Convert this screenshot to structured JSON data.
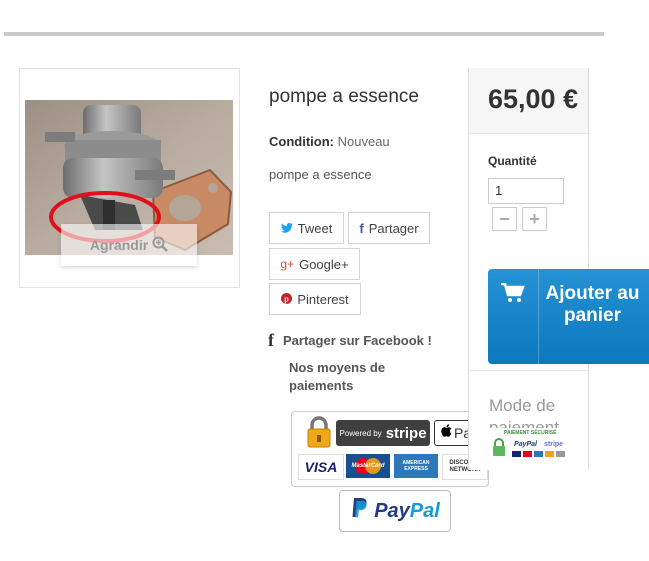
{
  "product": {
    "title": "pompe a essence",
    "condition_label": "Condition:",
    "condition_value": "Nouveau",
    "short_description": "pompe a essence",
    "zoom_label": "Agrandir",
    "zoom_icon": "magnifier-plus-icon"
  },
  "share": {
    "tweet": "Tweet",
    "partager": "Partager",
    "google": "Google+",
    "pinterest": "Pinterest",
    "facebook": "Partager sur Facebook !"
  },
  "payments": {
    "title": "Nos moyens de paiements",
    "stripe_powered": "Powered by",
    "stripe": "stripe",
    "apple_pay": "Pay",
    "visa": "VISA",
    "mastercard": "MasterCard",
    "amex": "AMERICAN EXPRESS",
    "discover": "DISCOVER NETWORK",
    "paypal": "PayPal"
  },
  "sidebar": {
    "price": "65,00 €",
    "quantity_label": "Quantité",
    "quantity_value": "1",
    "minus": "−",
    "plus": "+",
    "add_to_cart": "Ajouter au panier",
    "mode_paiement": "Mode de paiement",
    "secure_text": "PAIEMENT SÉCURISÉ",
    "secure_paypal": "PayPal",
    "secure_stripe": "stripe"
  },
  "colors": {
    "cart_blue": "#1588cc",
    "twitter": "#1da1f2",
    "facebook": "#3b5998",
    "google": "#dd4b39",
    "pinterest": "#cb2027",
    "paypal_dark": "#253b80",
    "paypal_light": "#179bd7"
  }
}
